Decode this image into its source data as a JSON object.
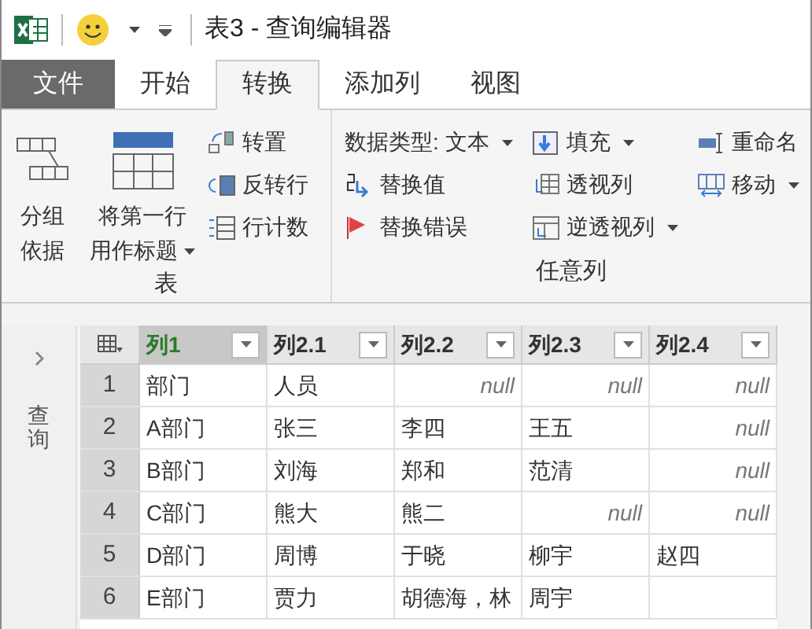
{
  "window": {
    "title": "表3 - 查询编辑器"
  },
  "tabs": [
    {
      "label": "文件",
      "kind": "file",
      "selected": false
    },
    {
      "label": "开始",
      "kind": "tab",
      "selected": false
    },
    {
      "label": "转换",
      "kind": "tab",
      "selected": true
    },
    {
      "label": "添加列",
      "kind": "tab",
      "selected": false
    },
    {
      "label": "视图",
      "kind": "tab",
      "selected": false
    }
  ],
  "ribbon": {
    "groups": [
      {
        "label": "表",
        "large": [
          {
            "lines": [
              "分组",
              "依据"
            ],
            "dropdown": false
          },
          {
            "lines": [
              "将第一行",
              "用作标题"
            ],
            "dropdown": true
          }
        ],
        "columns": [
          [
            {
              "label": "转置",
              "dropdown": false
            },
            {
              "label": "反转行",
              "dropdown": false
            },
            {
              "label": "行计数",
              "dropdown": false
            }
          ]
        ]
      },
      {
        "label": "任意列",
        "columns": [
          [
            {
              "label": "数据类型: 文本",
              "dropdown": true
            },
            {
              "label": "替换值",
              "dropdown": false
            },
            {
              "label": "替换错误",
              "dropdown": false
            }
          ],
          [
            {
              "label": "填充",
              "dropdown": true
            },
            {
              "label": "透视列",
              "dropdown": false
            },
            {
              "label": "逆透视列",
              "dropdown": true
            }
          ],
          [
            {
              "label": "重命名",
              "dropdown": false
            },
            {
              "label": "移动",
              "dropdown": true
            }
          ]
        ]
      }
    ]
  },
  "side_panel": {
    "label": "查询",
    "expanded": false
  },
  "table": {
    "columns": [
      {
        "label": "列1",
        "selected": true
      },
      {
        "label": "列2.1",
        "selected": false
      },
      {
        "label": "列2.2",
        "selected": false
      },
      {
        "label": "列2.3",
        "selected": false
      },
      {
        "label": "列2.4",
        "selected": false
      }
    ],
    "rows": [
      {
        "index": "1",
        "cells": [
          {
            "text": "部门",
            "kind": "text"
          },
          {
            "text": "人员",
            "kind": "text"
          },
          {
            "text": "null",
            "kind": "null"
          },
          {
            "text": "null",
            "kind": "null"
          },
          {
            "text": "null",
            "kind": "null"
          }
        ]
      },
      {
        "index": "2",
        "cells": [
          {
            "text": "A部门",
            "kind": "text"
          },
          {
            "text": "张三",
            "kind": "text"
          },
          {
            "text": "李四",
            "kind": "text"
          },
          {
            "text": "王五",
            "kind": "text"
          },
          {
            "text": "null",
            "kind": "null"
          }
        ]
      },
      {
        "index": "3",
        "cells": [
          {
            "text": "B部门",
            "kind": "text"
          },
          {
            "text": "刘海",
            "kind": "text"
          },
          {
            "text": "郑和",
            "kind": "text"
          },
          {
            "text": "范清",
            "kind": "text"
          },
          {
            "text": "null",
            "kind": "null"
          }
        ]
      },
      {
        "index": "4",
        "cells": [
          {
            "text": "C部门",
            "kind": "text"
          },
          {
            "text": "熊大",
            "kind": "text"
          },
          {
            "text": "熊二",
            "kind": "text"
          },
          {
            "text": "null",
            "kind": "null"
          },
          {
            "text": "null",
            "kind": "null"
          }
        ]
      },
      {
        "index": "5",
        "cells": [
          {
            "text": "D部门",
            "kind": "text"
          },
          {
            "text": "周博",
            "kind": "text"
          },
          {
            "text": "于晓",
            "kind": "text"
          },
          {
            "text": "柳宇",
            "kind": "text"
          },
          {
            "text": "赵四",
            "kind": "text"
          }
        ]
      },
      {
        "index": "6",
        "cells": [
          {
            "text": "E部门",
            "kind": "text"
          },
          {
            "text": "贾力",
            "kind": "text"
          },
          {
            "text": "胡德海，林",
            "kind": "text"
          },
          {
            "text": "周宇",
            "kind": "text"
          },
          {
            "kind": "empty"
          }
        ]
      }
    ]
  }
}
